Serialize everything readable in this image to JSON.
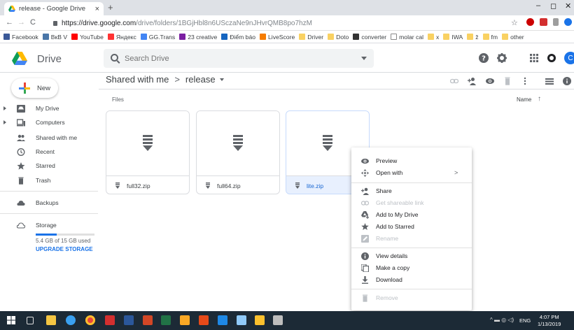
{
  "browser": {
    "tab_title": "release - Google Drive",
    "tab_close": "×",
    "new_tab": "+",
    "url_host": "https://drive.google.com",
    "url_path": "/drive/folders/1BGjHbl8n6USczaNe9nJHvrQMB8po7hzM",
    "win_min": "–",
    "win_max": "◻",
    "win_close": "✕",
    "back": "←",
    "forward": "→",
    "reload": "C",
    "star": "☆"
  },
  "bookmarks": [
    {
      "label": "Facebook",
      "color": "#3b5998"
    },
    {
      "label": "ВкВ V",
      "color": "#4a76a8"
    },
    {
      "label": "YouTube",
      "color": "#ff0000"
    },
    {
      "label": "Яндекс",
      "color": "#ff3333"
    },
    {
      "label": "GG.Trans",
      "color": "#4285f4"
    },
    {
      "label": "23 creative",
      "color": "#7b1fa2"
    },
    {
      "label": "Điểm báo",
      "color": "#1565c0"
    },
    {
      "label": "LiveScore",
      "color": "#f57c00"
    },
    {
      "label": "Driver",
      "color": "#f9d162"
    },
    {
      "label": "Doto",
      "color": "#f9d162"
    },
    {
      "label": "converter",
      "color": "#333333"
    },
    {
      "label": "molar cal",
      "color": "#ffffff"
    },
    {
      "label": "x",
      "color": "#f9d162"
    },
    {
      "label": "IWA",
      "color": "#f9d162"
    },
    {
      "label": "ž",
      "color": "#f9d162"
    },
    {
      "label": "fm",
      "color": "#f9d162"
    },
    {
      "label": "other",
      "color": "#f9d162"
    }
  ],
  "drive": {
    "brand": "Drive",
    "search_placeholder": "Search Drive",
    "avatar_letter": "C",
    "new_label": "New"
  },
  "sidebar": {
    "items": [
      {
        "label": "My Drive",
        "icon": "my-drive-icon"
      },
      {
        "label": "Computers",
        "icon": "computers-icon"
      },
      {
        "label": "Shared with me",
        "icon": "shared-icon"
      },
      {
        "label": "Recent",
        "icon": "clock-icon"
      },
      {
        "label": "Starred",
        "icon": "star-icon"
      },
      {
        "label": "Trash",
        "icon": "trash-icon"
      },
      {
        "label": "Backups",
        "icon": "cloud-icon"
      },
      {
        "label": "Storage",
        "icon": "storage-cloud-icon"
      }
    ],
    "storage_text": "5.4 GB of 15 GB used",
    "storage_fraction": 0.36,
    "upgrade": "UPGRADE STORAGE"
  },
  "main": {
    "crumb_parent": "Shared with me",
    "crumb_sep": ">",
    "crumb_current": "release",
    "section_label": "Files",
    "sort_label": "Name",
    "sort_arrow": "↑",
    "files": [
      {
        "name": "full32.zip",
        "selected": false
      },
      {
        "name": "full64.zip",
        "selected": false
      },
      {
        "name": "lite.zip",
        "selected": true
      }
    ]
  },
  "context_menu": {
    "items": [
      {
        "label": "Preview",
        "icon": "eye-icon",
        "disabled": false
      },
      {
        "label": "Open with",
        "icon": "open-with-icon",
        "disabled": false,
        "submenu": ">"
      },
      {
        "label": "Share",
        "icon": "add-person-icon",
        "disabled": false
      },
      {
        "label": "Get shareable link",
        "icon": "link-icon",
        "disabled": true
      },
      {
        "label": "Add to My Drive",
        "icon": "add-to-drive-icon",
        "disabled": false
      },
      {
        "label": "Add to Starred",
        "icon": "star-icon",
        "disabled": false
      },
      {
        "label": "Rename",
        "icon": "rename-icon",
        "disabled": true
      },
      {
        "label": "View details",
        "icon": "info-icon",
        "disabled": false
      },
      {
        "label": "Make a copy",
        "icon": "copy-icon",
        "disabled": false
      },
      {
        "label": "Download",
        "icon": "download-icon",
        "disabled": false
      },
      {
        "label": "Remove",
        "icon": "trash-icon",
        "disabled": true
      }
    ]
  },
  "taskbar": {
    "time": "4:07 PM",
    "date": "1/13/2019",
    "lang": "ENG"
  },
  "colors": {
    "accent": "#1a73e8",
    "selected_bg": "#e8f0fe",
    "taskbar": "#1c2a36"
  }
}
